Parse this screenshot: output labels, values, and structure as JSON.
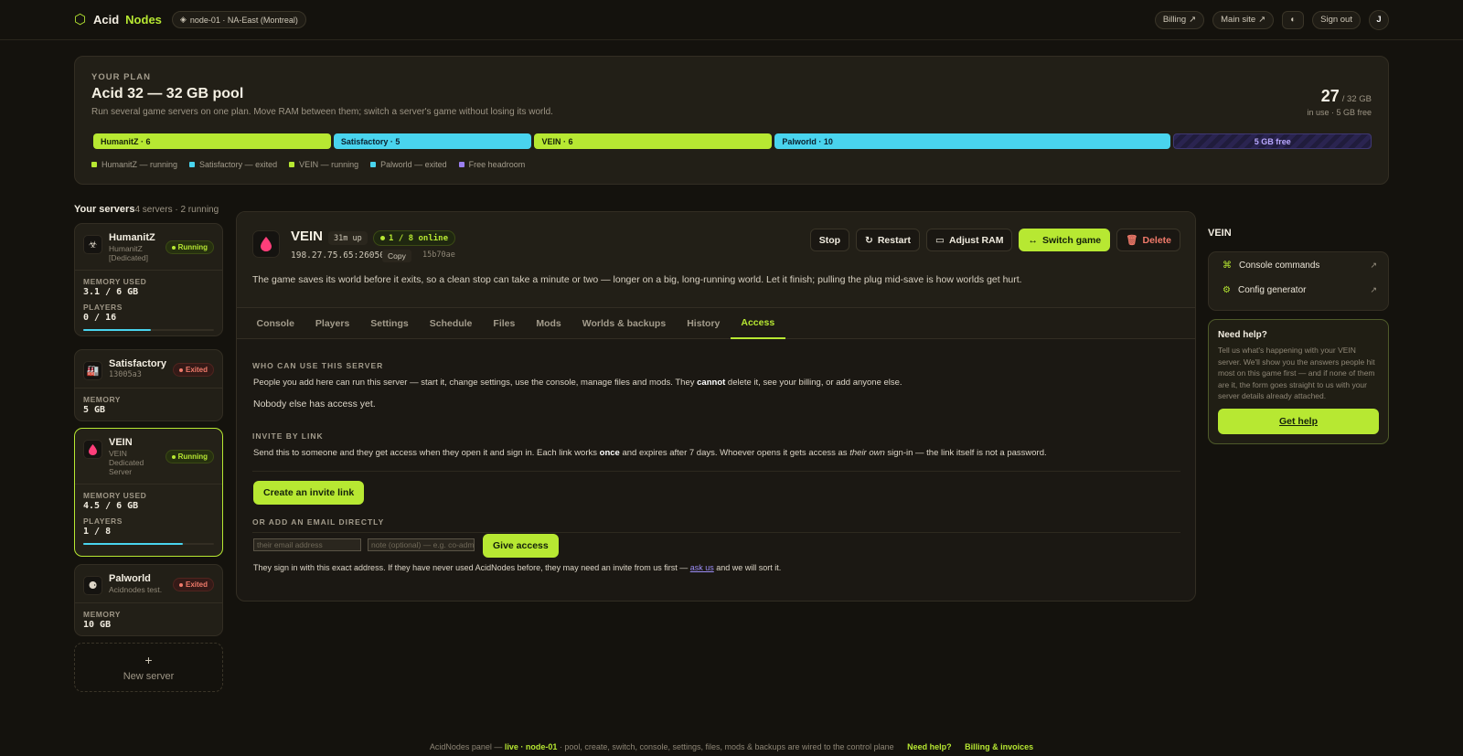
{
  "header": {
    "brand_a": "Acid",
    "brand_b": "Nodes",
    "node": "node-01 · NA-East (Montreal)",
    "billing": "Billing",
    "main_site": "Main site",
    "sign_out": "Sign out",
    "avatar": "J"
  },
  "plan": {
    "kicker": "YOUR PLAN",
    "title": "Acid 32 — 32 GB pool",
    "subtitle": "Run several game servers on one plan. Move RAM between them; switch a server's game without losing its world.",
    "used": "27",
    "total": "/ 32 GB",
    "note": "in use · 5 GB free",
    "segments": [
      {
        "label": "HumanitZ · 6",
        "gb": 6
      },
      {
        "label": "Satisfactory · 5",
        "gb": 5
      },
      {
        "label": "VEIN · 6",
        "gb": 6
      },
      {
        "label": "Palworld · 10",
        "gb": 10
      },
      {
        "label": "5 GB free",
        "gb": 5
      }
    ],
    "legend": [
      "HumanitZ — running",
      "Satisfactory — exited",
      "VEIN — running",
      "Palworld — exited",
      "Free headroom"
    ],
    "colors": {
      "running": "#b7e832",
      "exited": "#49d4ee",
      "free": "#9b7ff0"
    }
  },
  "servers": {
    "heading": "Your servers",
    "count": "4 servers · 2 running",
    "items": [
      {
        "name": "HumanitZ",
        "desc": "HumanitZ [Dedicated]",
        "status": "Running",
        "mem_label": "MEMORY USED",
        "mem": "3.1 / 6 GB",
        "players_label": "PLAYERS",
        "players": "0 / 16",
        "progress": 0.52
      },
      {
        "name": "Satisfactory",
        "desc": "13005a3",
        "status": "Exited",
        "mem_label": "MEMORY",
        "mem": "5 GB"
      },
      {
        "name": "VEIN",
        "desc": "VEIN Dedicated Server",
        "status": "Running",
        "mem_label": "MEMORY USED",
        "mem": "4.5 / 6 GB",
        "players_label": "PLAYERS",
        "players": "1 / 8",
        "progress": 0.76
      },
      {
        "name": "Palworld",
        "desc": "Acidnodes test.",
        "status": "Exited",
        "mem_label": "MEMORY",
        "mem": "10 GB"
      }
    ],
    "new_label": "New server"
  },
  "main": {
    "name": "VEIN",
    "uptime": "31m up",
    "online": "1 / 8 online",
    "ip": "198.27.75.65:26050",
    "copy": "Copy",
    "hash": "15b70ae",
    "actions": {
      "stop": "Stop",
      "restart": "Restart",
      "adjust": "Adjust RAM",
      "switch": "Switch game",
      "delete": "Delete"
    },
    "warning": "The game saves its world before it exits, so a clean stop can take a minute or two — longer on a big, long-running world. Let it finish; pulling the plug mid-save is how worlds get hurt.",
    "tabs": [
      "Console",
      "Players",
      "Settings",
      "Schedule",
      "Files",
      "Mods",
      "Worlds & backups",
      "History",
      "Access"
    ],
    "access": {
      "who_title": "WHO CAN USE THIS SERVER",
      "who_text_a": "People you add here can run this server — start it, change settings, use the console, manage files and mods. They ",
      "who_text_b": "cannot",
      "who_text_c": " delete it, see your billing, or add anyone else.",
      "nobody": "Nobody else has access yet.",
      "invite_title": "INVITE BY LINK",
      "invite_a": "Send this to someone and they get access when they open it and sign in. Each link works ",
      "invite_b": "once",
      "invite_c": " and expires after 7 days. Whoever opens it gets access as ",
      "invite_d": "their own",
      "invite_e": " sign-in — the link itself is not a password.",
      "create_btn": "Create an invite link",
      "email_title": "OR ADD AN EMAIL DIRECTLY",
      "email_placeholder": "their email address",
      "note_placeholder": "note (optional) — e.g. co-admin",
      "give_btn": "Give access",
      "foot_a": "They sign in with this exact address. If they have never used AcidNodes before, they may need an invite from us first — ",
      "foot_link": "ask us",
      "foot_b": " and we will sort it."
    }
  },
  "side": {
    "title": "VEIN",
    "console_cmds": "Console commands",
    "config_gen": "Config generator",
    "help_title": "Need help?",
    "help_text": "Tell us what's happening with your VEIN server. We'll show you the answers people hit most on this game first — and if none of them are it, the form goes straight to us with your server details already attached.",
    "help_btn": "Get help"
  },
  "footer": {
    "a": "AcidNodes panel — ",
    "live": "live · node-01",
    "b": " · pool, create, switch, console, settings, files, mods & backups are wired to the control plane",
    "need_help": "Need help?",
    "billing": "Billing & invoices"
  }
}
